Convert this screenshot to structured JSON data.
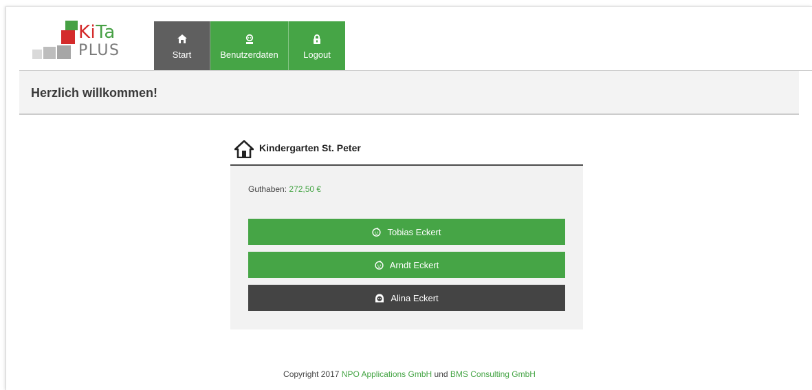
{
  "logo": {
    "kita_part1": "Ki",
    "kita_part2": "Ta",
    "plus": "PLUS"
  },
  "nav": {
    "items": [
      {
        "label": "Start",
        "icon": "home-icon"
      },
      {
        "label": "Benutzerdaten",
        "icon": "user-icon"
      },
      {
        "label": "Logout",
        "icon": "lock-icon"
      }
    ]
  },
  "page": {
    "title": "Herzlich willkommen!"
  },
  "kindergarten": {
    "name": "Kindergarten St. Peter",
    "balance_label": "Guthaben:",
    "balance_value": "272,50 €",
    "children": [
      {
        "name": "Tobias Eckert",
        "icon": "baby-icon"
      },
      {
        "name": "Arndt Eckert",
        "icon": "baby-icon"
      },
      {
        "name": "Alina Eckert",
        "icon": "girl-icon"
      }
    ]
  },
  "footer": {
    "prefix": "Copyright 2017",
    "company1": "NPO Applications GmbH",
    "conjunction": "und",
    "company2": "BMS Consulting GmbH"
  },
  "colors": {
    "brand_green": "#46a546",
    "nav_dark": "#5f5f5f",
    "button_dark": "#444444",
    "logo_red": "#d42b2b"
  }
}
